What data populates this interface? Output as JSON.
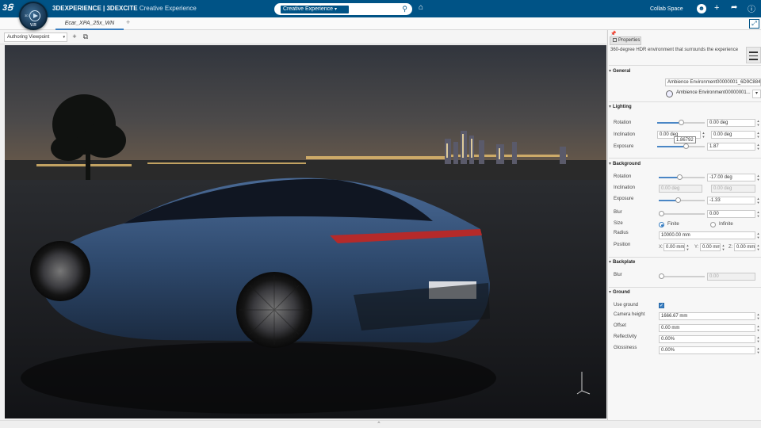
{
  "topbar": {
    "compass_version": "V.R",
    "compass_quadrant": "3D",
    "brand_bold": "3DEXPERIENCE | 3DEXCITE",
    "brand_sub": "Creative Experience",
    "search_selector": "Creative Experience",
    "space": "Collab Space"
  },
  "tabs": {
    "active": "Ecar_XPA_25x_WN",
    "add": "+"
  },
  "toolbar": {
    "viewpoint": "Authoring Viewpoint"
  },
  "viewport": {
    "tooltip": "1.86792"
  },
  "panel": {
    "tab_label": "Properties",
    "description": "360-degree HDR environment that surrounds the experience",
    "general": {
      "title": "General",
      "env_id": "Ambience Environment00000001_6D9C8840",
      "env_name": "Ambience Environment00000001..."
    },
    "lighting": {
      "title": "Lighting",
      "rotation_label": "Rotation",
      "rotation": "0.00 deg",
      "rotation_level": 0.5,
      "inclination_label": "Inclination",
      "inclination_min": "0.00 deg",
      "inclination_max": "0.00 deg",
      "exposure_label": "Exposure",
      "exposure": "1.87",
      "exposure_level": 0.6
    },
    "background": {
      "title": "Background",
      "rotation_label": "Rotation",
      "rotation": "-17.00 deg",
      "rotation_level": 0.45,
      "inclination_label": "Inclination",
      "inclination_min": "0.00 deg",
      "inclination_max": "0.00 deg",
      "exposure_label": "Exposure",
      "exposure": "-1.33",
      "exposure_level": 0.42,
      "blur_label": "Blur",
      "blur": "0.00",
      "blur_level": 0.0,
      "size_label": "Size",
      "size_finite": "Finite",
      "size_infinite": "Infinite",
      "radius_label": "Radius",
      "radius": "10000.00 mm",
      "position_label": "Position",
      "pos_x_label": "X:",
      "pos_x": "0.00 mm",
      "pos_y_label": "Y:",
      "pos_y": "0.00 mm",
      "pos_z_label": "Z:",
      "pos_z": "0.00 mm"
    },
    "backplate": {
      "title": "Backplate",
      "blur_label": "Blur",
      "blur": "0.00",
      "blur_level": 0.0
    },
    "ground": {
      "title": "Ground",
      "use_ground_label": "Use ground",
      "use_ground": true,
      "camera_height_label": "Camera height",
      "camera_height": "1666.67 mm",
      "offset_label": "Offset",
      "offset": "0.00 mm",
      "reflectivity_label": "Reflectivity",
      "reflectivity": "0.00%",
      "glossiness_label": "Glossiness",
      "glossiness": "0.00%"
    }
  },
  "colors": {
    "brand": "#005386",
    "accent": "#3a7fc2",
    "car_body": "#2f4a6e"
  }
}
